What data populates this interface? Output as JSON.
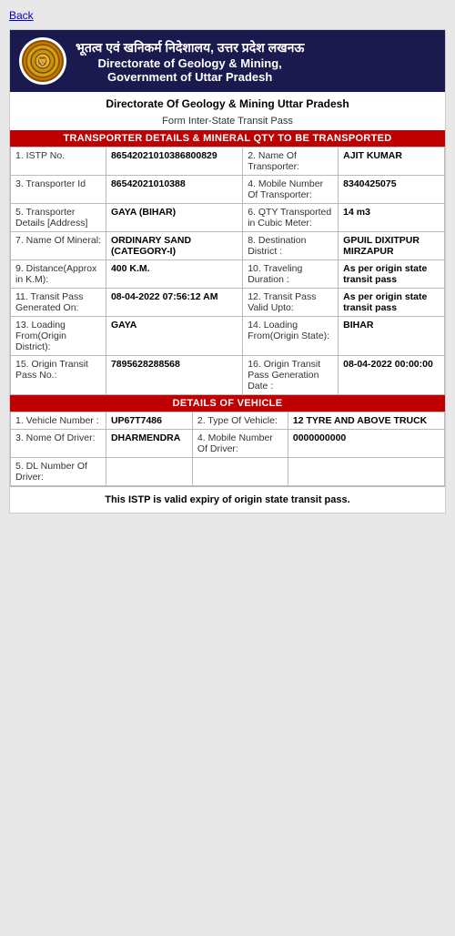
{
  "back_link": "Back",
  "header": {
    "hindi_text": "भूतत्व एवं खनिकर्म निदेशालय, उत्तर प्रदेश लखनऊ",
    "line1": "Directorate of Geology & Mining,",
    "line2": "Government of Uttar Pradesh",
    "logo_text": "UP"
  },
  "sub_header": "Directorate Of Geology & Mining Uttar Pradesh",
  "form_title": "Form Inter-State Transit Pass",
  "section1_title": "Transporter Details & Mineral QTY to be Transported",
  "transporter_fields": [
    {
      "label": "1. ISTP No.",
      "value": "86542021010386800829"
    },
    {
      "label": "2. Name Of Transporter:",
      "value": "AJIT KUMAR"
    },
    {
      "label": "3. Transporter Id",
      "value": "86542021010388"
    },
    {
      "label": "4. Mobile Number Of Transporter:",
      "value": "8340425075"
    },
    {
      "label": "5. Transporter Details [Address]",
      "value": "GAYA (BIHAR)"
    },
    {
      "label": "6. QTY Transported in Cubic Meter:",
      "value": "14 m3"
    },
    {
      "label": "7. Name Of Mineral:",
      "value": "ORDINARY SAND (CATEGORY-I)"
    },
    {
      "label": "8. Destination District :",
      "value": "GPUIL DIXITPUR MIRZAPUR"
    },
    {
      "label": "9. Distance(Approx in K.M):",
      "value": "400 K.M."
    },
    {
      "label": "10. Traveling Duration :",
      "value": "As per origin state transit pass"
    },
    {
      "label": "11. Transit Pass Generated On:",
      "value": "08-04-2022 07:56:12 AM"
    },
    {
      "label": "12. Transit Pass Valid Upto:",
      "value": "As per origin state transit pass"
    },
    {
      "label": "13. Loading From(Origin District):",
      "value": "GAYA"
    },
    {
      "label": "14. Loading From(Origin State):",
      "value": "BIHAR"
    },
    {
      "label": "15. Origin Transit Pass No.:",
      "value": "7895628288568"
    },
    {
      "label": "16. Origin Transit Pass Generation Date :",
      "value": "08-04-2022  00:00:00"
    }
  ],
  "section2_title": "Details Of Vehicle",
  "vehicle_fields": [
    {
      "label": "1. Vehicle Number :",
      "value": "UP67T7486"
    },
    {
      "label": "2. Type Of Vehicle:",
      "value": "12 TYRE AND ABOVE TRUCK"
    },
    {
      "label": "3. Nome Of Driver:",
      "value": "DHARMENDRA"
    },
    {
      "label": "4. Mobile Number Of Driver:",
      "value": "0000000000"
    },
    {
      "label": "5. DL Number Of Driver:",
      "value": ""
    }
  ],
  "footer_note": "This ISTP is valid  expiry of origin state transit pass."
}
